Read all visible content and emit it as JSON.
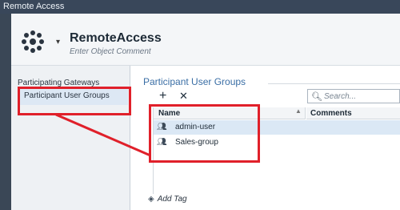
{
  "window": {
    "title": "Remote Access"
  },
  "object": {
    "name": "RemoteAccess",
    "comment_placeholder": "Enter Object Comment"
  },
  "sidebar": {
    "items": [
      {
        "label": "Participating Gateways"
      },
      {
        "label": "Participant User Groups"
      }
    ]
  },
  "main": {
    "section_title": "Participant User Groups",
    "toolbar": {
      "add_icon": "plus-icon",
      "remove_icon": "x-icon"
    },
    "search": {
      "placeholder": "Search..."
    },
    "table": {
      "columns": [
        "Name",
        "Comments"
      ],
      "rows": [
        {
          "name": "admin-user",
          "comments": ""
        },
        {
          "name": "Sales-group",
          "comments": ""
        }
      ]
    },
    "add_tag_label": "Add Tag"
  },
  "colors": {
    "highlight": "#e0202a",
    "accent": "#3a6ea5",
    "selected_row": "#dbe8f5"
  }
}
